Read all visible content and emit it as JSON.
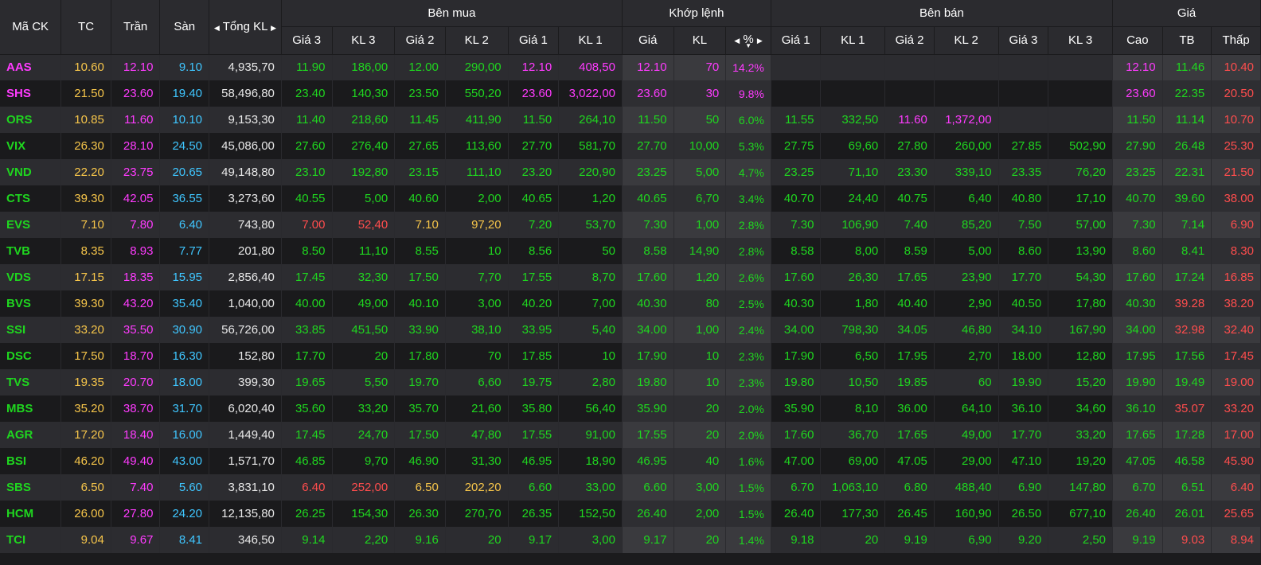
{
  "header": {
    "symbol": "Mã CK",
    "ref": "TC",
    "ceiling": "Trần",
    "floor": "Sàn",
    "total_vol": "Tổng KL",
    "buy_group": "Bên mua",
    "match_group": "Khớp lệnh",
    "sell_group": "Bên bán",
    "price_group": "Giá",
    "buy_cols": [
      "Giá 3",
      "KL 3",
      "Giá 2",
      "KL 2",
      "Giá 1",
      "KL 1"
    ],
    "match_cols": [
      "Giá",
      "KL",
      "%"
    ],
    "sell_cols": [
      "Giá 1",
      "KL 1",
      "Giá 2",
      "KL 2",
      "Giá 3",
      "KL 3"
    ],
    "price_cols": [
      "Cao",
      "TB",
      "Thấp"
    ]
  },
  "colors": {
    "ceiling": "#ff3bff",
    "floor": "#3fc6ff",
    "ref": "#f6c54a",
    "up": "#1fd61f",
    "down": "#ff4d4d",
    "neutral": "#e8e8e8"
  },
  "rows": [
    {
      "sym": "AAS",
      "tc": "10.60",
      "tran": "12.10",
      "san": "9.10",
      "tkl": "4,935,70",
      "b3p": "11.90",
      "b3v": "186,00",
      "b2p": "12.00",
      "b2v": "290,00",
      "b1p": "12.10",
      "b1v": "408,50",
      "mp": "12.10",
      "mv": "70",
      "pct": "14.2%",
      "s1p": "",
      "s1v": "",
      "s2p": "",
      "s2v": "",
      "s3p": "",
      "s3v": "",
      "cao": "12.10",
      "tb": "11.46",
      "thap": "10.40"
    },
    {
      "sym": "SHS",
      "tc": "21.50",
      "tran": "23.60",
      "san": "19.40",
      "tkl": "58,496,80",
      "b3p": "23.40",
      "b3v": "140,30",
      "b2p": "23.50",
      "b2v": "550,20",
      "b1p": "23.60",
      "b1v": "3,022,00",
      "mp": "23.60",
      "mv": "30",
      "pct": "9.8%",
      "s1p": "",
      "s1v": "",
      "s2p": "",
      "s2v": "",
      "s3p": "",
      "s3v": "",
      "cao": "23.60",
      "tb": "22.35",
      "thap": "20.50"
    },
    {
      "sym": "ORS",
      "tc": "10.85",
      "tran": "11.60",
      "san": "10.10",
      "tkl": "9,153,30",
      "b3p": "11.40",
      "b3v": "218,60",
      "b2p": "11.45",
      "b2v": "411,90",
      "b1p": "11.50",
      "b1v": "264,10",
      "mp": "11.50",
      "mv": "50",
      "pct": "6.0%",
      "s1p": "11.55",
      "s1v": "332,50",
      "s2p": "11.60",
      "s2v": "1,372,00",
      "s3p": "",
      "s3v": "",
      "cao": "11.50",
      "tb": "11.14",
      "thap": "10.70"
    },
    {
      "sym": "VIX",
      "tc": "26.30",
      "tran": "28.10",
      "san": "24.50",
      "tkl": "45,086,00",
      "b3p": "27.60",
      "b3v": "276,40",
      "b2p": "27.65",
      "b2v": "113,60",
      "b1p": "27.70",
      "b1v": "581,70",
      "mp": "27.70",
      "mv": "10,00",
      "pct": "5.3%",
      "s1p": "27.75",
      "s1v": "69,60",
      "s2p": "27.80",
      "s2v": "260,00",
      "s3p": "27.85",
      "s3v": "502,90",
      "cao": "27.90",
      "tb": "26.48",
      "thap": "25.30"
    },
    {
      "sym": "VND",
      "tc": "22.20",
      "tran": "23.75",
      "san": "20.65",
      "tkl": "49,148,80",
      "b3p": "23.10",
      "b3v": "192,80",
      "b2p": "23.15",
      "b2v": "111,10",
      "b1p": "23.20",
      "b1v": "220,90",
      "mp": "23.25",
      "mv": "5,00",
      "pct": "4.7%",
      "s1p": "23.25",
      "s1v": "71,10",
      "s2p": "23.30",
      "s2v": "339,10",
      "s3p": "23.35",
      "s3v": "76,20",
      "cao": "23.25",
      "tb": "22.31",
      "thap": "21.50"
    },
    {
      "sym": "CTS",
      "tc": "39.30",
      "tran": "42.05",
      "san": "36.55",
      "tkl": "3,273,60",
      "b3p": "40.55",
      "b3v": "5,00",
      "b2p": "40.60",
      "b2v": "2,00",
      "b1p": "40.65",
      "b1v": "1,20",
      "mp": "40.65",
      "mv": "6,70",
      "pct": "3.4%",
      "s1p": "40.70",
      "s1v": "24,40",
      "s2p": "40.75",
      "s2v": "6,40",
      "s3p": "40.80",
      "s3v": "17,10",
      "cao": "40.70",
      "tb": "39.60",
      "thap": "38.00"
    },
    {
      "sym": "EVS",
      "tc": "7.10",
      "tran": "7.80",
      "san": "6.40",
      "tkl": "743,80",
      "b3p": "7.00",
      "b3v": "52,40",
      "b2p": "7.10",
      "b2v": "97,20",
      "b1p": "7.20",
      "b1v": "53,70",
      "mp": "7.30",
      "mv": "1,00",
      "pct": "2.8%",
      "s1p": "7.30",
      "s1v": "106,90",
      "s2p": "7.40",
      "s2v": "85,20",
      "s3p": "7.50",
      "s3v": "57,00",
      "cao": "7.30",
      "tb": "7.14",
      "thap": "6.90"
    },
    {
      "sym": "TVB",
      "tc": "8.35",
      "tran": "8.93",
      "san": "7.77",
      "tkl": "201,80",
      "b3p": "8.50",
      "b3v": "11,10",
      "b2p": "8.55",
      "b2v": "10",
      "b1p": "8.56",
      "b1v": "50",
      "mp": "8.58",
      "mv": "14,90",
      "pct": "2.8%",
      "s1p": "8.58",
      "s1v": "8,00",
      "s2p": "8.59",
      "s2v": "5,00",
      "s3p": "8.60",
      "s3v": "13,90",
      "cao": "8.60",
      "tb": "8.41",
      "thap": "8.30"
    },
    {
      "sym": "VDS",
      "tc": "17.15",
      "tran": "18.35",
      "san": "15.95",
      "tkl": "2,856,40",
      "b3p": "17.45",
      "b3v": "32,30",
      "b2p": "17.50",
      "b2v": "7,70",
      "b1p": "17.55",
      "b1v": "8,70",
      "mp": "17.60",
      "mv": "1,20",
      "pct": "2.6%",
      "s1p": "17.60",
      "s1v": "26,30",
      "s2p": "17.65",
      "s2v": "23,90",
      "s3p": "17.70",
      "s3v": "54,30",
      "cao": "17.60",
      "tb": "17.24",
      "thap": "16.85"
    },
    {
      "sym": "BVS",
      "tc": "39.30",
      "tran": "43.20",
      "san": "35.40",
      "tkl": "1,040,00",
      "b3p": "40.00",
      "b3v": "49,00",
      "b2p": "40.10",
      "b2v": "3,00",
      "b1p": "40.20",
      "b1v": "7,00",
      "mp": "40.30",
      "mv": "80",
      "pct": "2.5%",
      "s1p": "40.30",
      "s1v": "1,80",
      "s2p": "40.40",
      "s2v": "2,90",
      "s3p": "40.50",
      "s3v": "17,80",
      "cao": "40.30",
      "tb": "39.28",
      "thap": "38.20"
    },
    {
      "sym": "SSI",
      "tc": "33.20",
      "tran": "35.50",
      "san": "30.90",
      "tkl": "56,726,00",
      "b3p": "33.85",
      "b3v": "451,50",
      "b2p": "33.90",
      "b2v": "38,10",
      "b1p": "33.95",
      "b1v": "5,40",
      "mp": "34.00",
      "mv": "1,00",
      "pct": "2.4%",
      "s1p": "34.00",
      "s1v": "798,30",
      "s2p": "34.05",
      "s2v": "46,80",
      "s3p": "34.10",
      "s3v": "167,90",
      "cao": "34.00",
      "tb": "32.98",
      "thap": "32.40"
    },
    {
      "sym": "DSC",
      "tc": "17.50",
      "tran": "18.70",
      "san": "16.30",
      "tkl": "152,80",
      "b3p": "17.70",
      "b3v": "20",
      "b2p": "17.80",
      "b2v": "70",
      "b1p": "17.85",
      "b1v": "10",
      "mp": "17.90",
      "mv": "10",
      "pct": "2.3%",
      "s1p": "17.90",
      "s1v": "6,50",
      "s2p": "17.95",
      "s2v": "2,70",
      "s3p": "18.00",
      "s3v": "12,80",
      "cao": "17.95",
      "tb": "17.56",
      "thap": "17.45"
    },
    {
      "sym": "TVS",
      "tc": "19.35",
      "tran": "20.70",
      "san": "18.00",
      "tkl": "399,30",
      "b3p": "19.65",
      "b3v": "5,50",
      "b2p": "19.70",
      "b2v": "6,60",
      "b1p": "19.75",
      "b1v": "2,80",
      "mp": "19.80",
      "mv": "10",
      "pct": "2.3%",
      "s1p": "19.80",
      "s1v": "10,50",
      "s2p": "19.85",
      "s2v": "60",
      "s3p": "19.90",
      "s3v": "15,20",
      "cao": "19.90",
      "tb": "19.49",
      "thap": "19.00"
    },
    {
      "sym": "MBS",
      "tc": "35.20",
      "tran": "38.70",
      "san": "31.70",
      "tkl": "6,020,40",
      "b3p": "35.60",
      "b3v": "33,20",
      "b2p": "35.70",
      "b2v": "21,60",
      "b1p": "35.80",
      "b1v": "56,40",
      "mp": "35.90",
      "mv": "20",
      "pct": "2.0%",
      "s1p": "35.90",
      "s1v": "8,10",
      "s2p": "36.00",
      "s2v": "64,10",
      "s3p": "36.10",
      "s3v": "34,60",
      "cao": "36.10",
      "tb": "35.07",
      "thap": "33.20"
    },
    {
      "sym": "AGR",
      "tc": "17.20",
      "tran": "18.40",
      "san": "16.00",
      "tkl": "1,449,40",
      "b3p": "17.45",
      "b3v": "24,70",
      "b2p": "17.50",
      "b2v": "47,80",
      "b1p": "17.55",
      "b1v": "91,00",
      "mp": "17.55",
      "mv": "20",
      "pct": "2.0%",
      "s1p": "17.60",
      "s1v": "36,70",
      "s2p": "17.65",
      "s2v": "49,00",
      "s3p": "17.70",
      "s3v": "33,20",
      "cao": "17.65",
      "tb": "17.28",
      "thap": "17.00"
    },
    {
      "sym": "BSI",
      "tc": "46.20",
      "tran": "49.40",
      "san": "43.00",
      "tkl": "1,571,70",
      "b3p": "46.85",
      "b3v": "9,70",
      "b2p": "46.90",
      "b2v": "31,30",
      "b1p": "46.95",
      "b1v": "18,90",
      "mp": "46.95",
      "mv": "40",
      "pct": "1.6%",
      "s1p": "47.00",
      "s1v": "69,00",
      "s2p": "47.05",
      "s2v": "29,00",
      "s3p": "47.10",
      "s3v": "19,20",
      "cao": "47.05",
      "tb": "46.58",
      "thap": "45.90"
    },
    {
      "sym": "SBS",
      "tc": "6.50",
      "tran": "7.40",
      "san": "5.60",
      "tkl": "3,831,10",
      "b3p": "6.40",
      "b3v": "252,00",
      "b2p": "6.50",
      "b2v": "202,20",
      "b1p": "6.60",
      "b1v": "33,00",
      "mp": "6.60",
      "mv": "3,00",
      "pct": "1.5%",
      "s1p": "6.70",
      "s1v": "1,063,10",
      "s2p": "6.80",
      "s2v": "488,40",
      "s3p": "6.90",
      "s3v": "147,80",
      "cao": "6.70",
      "tb": "6.51",
      "thap": "6.40"
    },
    {
      "sym": "HCM",
      "tc": "26.00",
      "tran": "27.80",
      "san": "24.20",
      "tkl": "12,135,80",
      "b3p": "26.25",
      "b3v": "154,30",
      "b2p": "26.30",
      "b2v": "270,70",
      "b1p": "26.35",
      "b1v": "152,50",
      "mp": "26.40",
      "mv": "2,00",
      "pct": "1.5%",
      "s1p": "26.40",
      "s1v": "177,30",
      "s2p": "26.45",
      "s2v": "160,90",
      "s3p": "26.50",
      "s3v": "677,10",
      "cao": "26.40",
      "tb": "26.01",
      "thap": "25.65"
    },
    {
      "sym": "TCI",
      "tc": "9.04",
      "tran": "9.67",
      "san": "8.41",
      "tkl": "346,50",
      "b3p": "9.14",
      "b3v": "2,20",
      "b2p": "9.16",
      "b2v": "20",
      "b1p": "9.17",
      "b1v": "3,00",
      "mp": "9.17",
      "mv": "20",
      "pct": "1.4%",
      "s1p": "9.18",
      "s1v": "20",
      "s2p": "9.19",
      "s2v": "6,90",
      "s3p": "9.20",
      "s3v": "2,50",
      "cao": "9.19",
      "tb": "9.03",
      "thap": "8.94"
    }
  ]
}
